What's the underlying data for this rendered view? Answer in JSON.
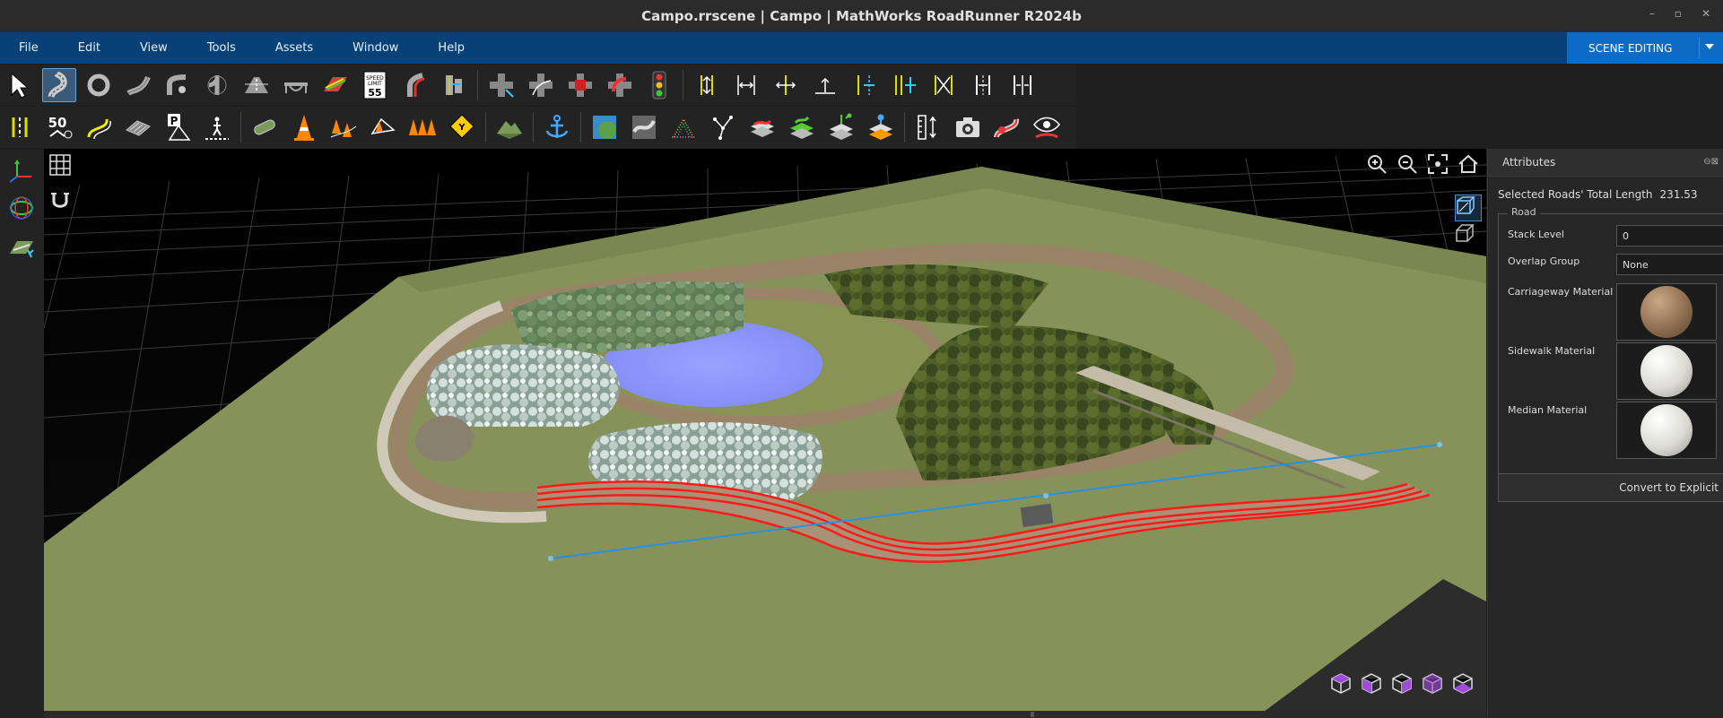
{
  "window": {
    "title": "Campo.rrscene | Campo | MathWorks RoadRunner R2024b",
    "controls": [
      "–",
      "▫",
      "✕"
    ]
  },
  "menu": [
    "File",
    "Edit",
    "View",
    "Tools",
    "Assets",
    "Window",
    "Help"
  ],
  "mode": {
    "label": "SCENE EDITING"
  },
  "toolbar_row1": [
    "select-tool",
    "road-plan-tool",
    "round-road-tool",
    "road-construction-tool",
    "corner-tool",
    "junction-tool",
    "lane-tool",
    "bridge-tool",
    "lane-marking-tool",
    "speed-limit-sign-tool",
    "lane-carve-tool",
    "lane-width-tool",
    "junction-carve-tool",
    "maneuver-tool",
    "crosswalk-tool",
    "signal-tool",
    "traffic-light-tool",
    "lane-add-tool",
    "lane-form-tool",
    "lane-width-adjust-tool",
    "lane-offset-tool",
    "lane-split-tool",
    "lane-add-right-tool",
    "lane-chain-tool",
    "lane-spread-tool",
    "lane-merge-tool"
  ],
  "toolbar_row2": [
    "lane-marking-chain-tool",
    "speed-limit-tool",
    "curve-road-tool",
    "surface-tool",
    "parking-tool",
    "crosswalk-marking-tool",
    "prop-curve-tool",
    "prop-point-tool",
    "prop-polygon-tool",
    "prop-set-tool",
    "prop-span-tool",
    "sign-tool",
    "elevation-map-tool",
    "anchor-tool",
    "aerial-imagery-tool",
    "elevation-tool",
    "point-cloud-tool",
    "vector-data-tool",
    "scene-layer-tool",
    "terrain-tool",
    "layer-add-tool",
    "layer-stack-tool",
    "measure-tool",
    "screenshot-tool",
    "scenario-tool",
    "scenario-view-tool"
  ],
  "left_tools": [
    "transform-icon",
    "rotate-icon",
    "road-marking-icon"
  ],
  "viewport": {
    "top_left_tools": [
      "grid-icon",
      "snap-magnet-icon"
    ],
    "camera_tools": [
      "zoom-in-icon",
      "zoom-out-icon",
      "frame-selection-icon",
      "home-icon"
    ],
    "projection_tools": [
      "perspective-view-icon",
      "orthographic-view-icon"
    ],
    "view_cubes": [
      "view-cube-top",
      "view-cube-front",
      "view-cube-left",
      "view-cube-right",
      "view-cube-back"
    ]
  },
  "attributes": {
    "title": "Attributes",
    "selected_label": "Selected Roads' Total Length",
    "selected_value": "231.53",
    "group": "Road",
    "stack_level_label": "Stack Level",
    "stack_level_value": "0",
    "overlap_label": "Overlap Group",
    "overlap_value": "None",
    "carriageway_label": "Carriageway Material",
    "sidewalk_label": "Sidewalk Material",
    "median_label": "Median Material",
    "convert_label": "Convert to Explicit"
  },
  "colors": {
    "menubar": "#074177",
    "mode_button": "#0b6bc6",
    "terrain": "#86925a",
    "lake": "#8a95fb",
    "selected_road": "#ff1a1a",
    "selection_line": "#2a90e0"
  }
}
